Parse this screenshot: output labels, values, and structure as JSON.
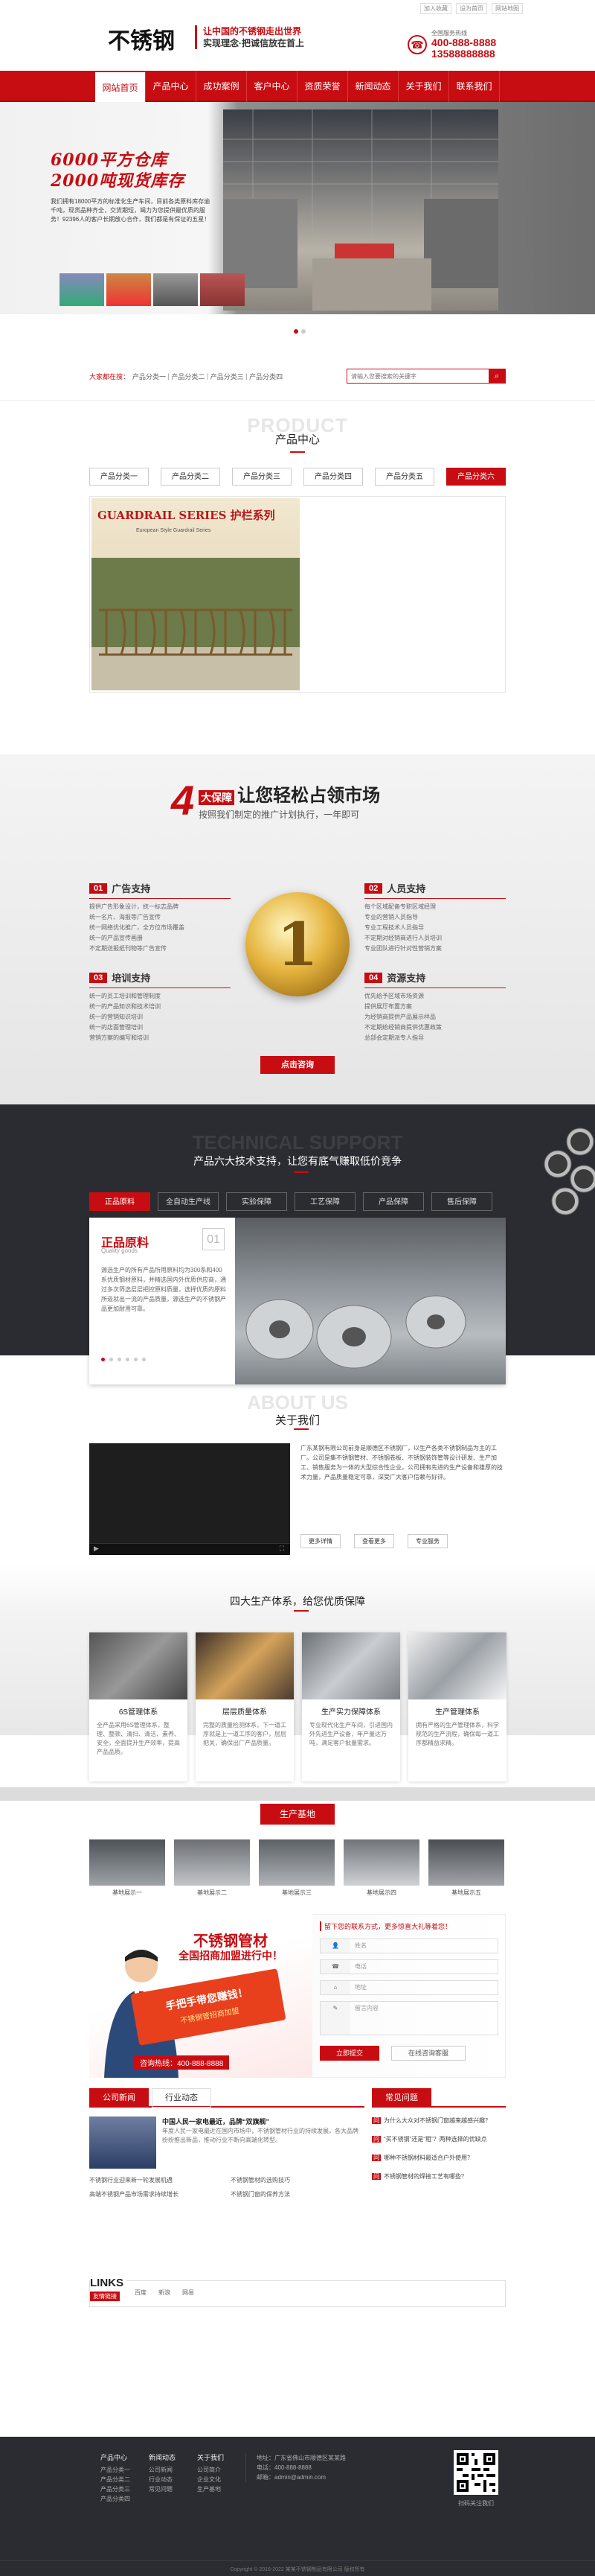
{
  "header": {
    "logo": "不锈钢",
    "slogan1": "让中国的不锈钢走出世界",
    "slogan2": "实现理念·把诚信放在首上",
    "toplinks": [
      "加入收藏",
      "设为首页",
      "网站地图"
    ],
    "hotline_label": "全国服务热线",
    "phone1": "400-888-8888",
    "phone2": "13588888888"
  },
  "nav": [
    "网站首页",
    "产品中心",
    "成功案例",
    "客户中心",
    "资质荣誉",
    "新闻动态",
    "关于我们",
    "联系我们"
  ],
  "banner": {
    "title1": "6000平方仓库",
    "title2": "2000吨现货库存",
    "text": "我们拥有18000平方的标准化生产车间，目前各类原料库存逾千吨，现货品种齐全，交货期短，竭力为您提供最优质的服务！92396人的客户长期放心合作，我们都是有保证的五星！"
  },
  "search": {
    "label": "大家都在搜：",
    "keywords": [
      "产品分类一",
      "产品分类二",
      "产品分类三",
      "产品分类四"
    ],
    "placeholder": "请输入您要搜索的关键字"
  },
  "products": {
    "en": "PRODUCT",
    "title": "产品中心",
    "tabs": [
      "产品分类一",
      "产品分类二",
      "产品分类三",
      "产品分类四",
      "产品分类五",
      "产品分类六"
    ],
    "img_title": "GUARDRAIL SERIES 护栏系列",
    "img_sub": "European Style Guardrail Series"
  },
  "advantage": {
    "num": "4",
    "num_label": "大保障",
    "title": "让您轻松占领市场",
    "subtitle": "按照我们制定的推广计划执行，一年即可",
    "items": [
      {
        "no": "01",
        "title": "广告支持",
        "lines": [
          "提供广告形象设计，统一标志品牌",
          "统一名片、海报等广告宣传",
          "统一网络优化推广，全方位市场覆盖",
          "统一的产品宣传画册",
          "不定期送报纸刊物等广告宣传"
        ]
      },
      {
        "no": "02",
        "title": "人员支持",
        "lines": [
          "每个区域配备专职区域经理",
          "专业的营销人员指导",
          "专业工程技术人员指导",
          "不定期对经销商进行人员培训",
          "专业团队进行针对性营销方案"
        ]
      },
      {
        "no": "03",
        "title": "培训支持",
        "lines": [
          "统一的员工培训和管理制度",
          "统一的产品知识和技术培训",
          "统一的营销知识培训",
          "统一的店面管理培训",
          "营销方案的编写和培训"
        ]
      },
      {
        "no": "04",
        "title": "资源支持",
        "lines": [
          "优先给予区域市场资源",
          "提供展厅布置方案",
          "为经销商提供产品展示样品",
          "不定期给经销商提供优惠政策",
          "总部会定期派专人指导"
        ]
      }
    ],
    "button": "点击咨询"
  },
  "tech": {
    "en": "TECHNICAL SUPPORT",
    "title": "产品六大技术支持，让您有底气赚取低价竞争",
    "tabs": [
      "正品原料",
      "全自动生产线",
      "实验保障",
      "工艺保障",
      "产品保障",
      "售后保障"
    ],
    "card_title": "正品原料",
    "card_sub": "Quality goods",
    "card_no": "01",
    "card_text": "源选生产的所有产品所用原料均为300系和400系优质钢材原料，并精选国内外优质供应商，通过多次筛选层层把控原料质量，选择优质的原料所造就出一流的产品质量，源选生产的不锈钢产品更加耐用可靠。"
  },
  "about": {
    "en": "ABOUT US",
    "title": "关于我们",
    "text": "广东某钢有限公司前身是顺德区不锈钢厂，以生产各类不锈钢制品为主的工厂。公司是集不锈钢管材、不锈钢卷板、不锈钢装饰管等设计研发、生产加工、销售服务为一体的大型综合性企业。公司拥有先进的生产设备和雄厚的技术力量，产品质量稳定可靠，深受广大客户信赖与好评。",
    "buttons": [
      "更多详情",
      "查看更多",
      "专业服务"
    ]
  },
  "guarantee": {
    "title": "四大生产体系，给您优质保障",
    "items": [
      {
        "title": "6S管理体系",
        "text": "全产品采用6S管理体系，整理、整顿、清扫、清洁、素养、安全，全面提升生产效率，提高产品品质。"
      },
      {
        "title": "层层质量体系",
        "text": "完整的质量检测体系，下一道工序就是上一道工序的客户，层层把关，确保出厂产品质量。"
      },
      {
        "title": "生产实力保障体系",
        "text": "专业现代化生产车间，引进国内外先进生产设备，年产量达万吨，满足客户批量需求。"
      },
      {
        "title": "生产管理体系",
        "text": "拥有严格的生产管理体系，科学规范的生产流程，确保每一道工序都精益求精。"
      }
    ]
  },
  "production": {
    "title": "生产基地",
    "items": [
      "基地展示一",
      "基地展示二",
      "基地展示三",
      "基地展示四",
      "基地展示五"
    ]
  },
  "contact": {
    "big1": "不锈钢管材",
    "big2": "全国招商加盟进行中！",
    "flag1": "手把手带您赚钱！",
    "flag2": "不锈钢管招商加盟",
    "hotline_label": "咨询热线：",
    "hotline": "400-888-8888",
    "form_title": "留下您的联系方式，更多惊喜大礼等着您！",
    "fields": [
      "姓名",
      "电话",
      "地址",
      "留言内容"
    ],
    "submit": "立即提交",
    "reset": "在线咨询客服"
  },
  "news": {
    "tabs": [
      "公司新闻",
      "行业动态"
    ],
    "faq_title": "常见问题",
    "headline": "中国人民一家电最近，品牌“双旗舰”",
    "headline_text": "年度人民一家电最近在国内市场中，不锈钢管材行业的持续发展，各大品牌纷纷推出新品，推动行业不断向高端化转型。",
    "list": [
      "不锈钢行业迎来新一轮发展机遇",
      "不锈钢管材的选购技巧",
      "高端不锈钢产品市场需求持续增长",
      "不锈钢门窗的保养方法"
    ],
    "faq": [
      "为什么大众对不锈钢门窗越来越感兴趣？",
      "“买不锈钢”还是“租”？两种选择的优缺点",
      "哪种不锈钢材料最适合户外使用？",
      "不锈钢管材的焊接工艺有哪些？"
    ]
  },
  "links": {
    "title": "LINKS",
    "sub": "友情链接",
    "items": [
      "百度",
      "新浪",
      "网易"
    ]
  },
  "footer": {
    "cols": [
      {
        "h": "产品中心",
        "items": [
          "产品分类一",
          "产品分类二",
          "产品分类三",
          "产品分类四"
        ]
      },
      {
        "h": "新闻动态",
        "items": [
          "公司新闻",
          "行业动态",
          "常见问题"
        ]
      },
      {
        "h": "关于我们",
        "items": [
          "公司简介",
          "企业文化",
          "生产基地"
        ]
      }
    ],
    "contact": [
      "地址：广东省佛山市顺德区某某路",
      "电话：400-888-8888",
      "邮箱：admin@admin.com"
    ],
    "qr": "扫码关注我们",
    "copy": "Copyright © 2016-2022 某某不锈钢制品有限公司 版权所有"
  }
}
